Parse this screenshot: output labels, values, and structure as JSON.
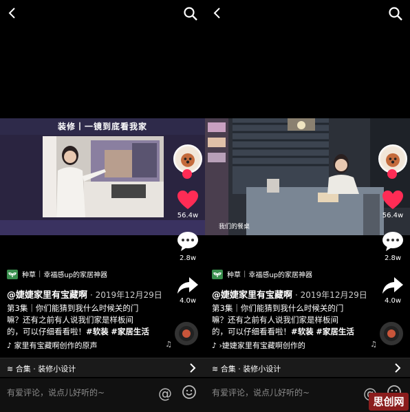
{
  "panels": [
    {
      "video_title": "装修丨一镜到底看我家",
      "video_caption": "",
      "likes": "56.4w",
      "comments": "2.8w",
      "shares": "4.0w",
      "tag": "种草",
      "tag_detail": "幸福感up的家居神器",
      "author": "@婕婕家里有宝藏啊",
      "date": "· 2019年12月29日",
      "desc_line1": "第3集｜你们能猜到我什么时候关的门",
      "desc_line2": "嘛？还有之前有人说我们家是样板间",
      "desc_line3_plain": "的，可以仔细看看啦！",
      "hashtag1": "#软装",
      "hashtag2": "#家居生活",
      "music": "家里有宝藏啊创作的原声",
      "collection": "合集 · 装修小设计",
      "comment_placeholder": "有爱评论，说点儿好听的~"
    },
    {
      "video_title": "",
      "video_caption": "我们的餐桌",
      "likes": "56.4w",
      "comments": "2.8w",
      "shares": "4.0w",
      "tag": "种草",
      "tag_detail": "幸福感up的家居神器",
      "author": "@婕婕家里有宝藏啊",
      "date": "· 2019年12月29日",
      "desc_line1": "第3集｜你们能猜到我什么时候关的门",
      "desc_line2": "嘛？还有之前有人说我们家是样板间",
      "desc_line3_plain": "的，可以仔细看看啦！",
      "hashtag1": "#软装",
      "hashtag2": "#家居生活",
      "music": "›婕婕家里有宝藏啊创作的",
      "collection": "合集 · 装修小设计",
      "comment_placeholder": "有爱评论，说点儿好听的~"
    }
  ],
  "watermark": "思创网",
  "colors": {
    "like": "#fe2c55",
    "tag": "#3a8f4e",
    "background": "#000000"
  },
  "icons": [
    "back-icon",
    "search-icon",
    "heart-icon",
    "comment-icon",
    "share-icon",
    "music-note-icon",
    "collection-icon",
    "chevron-right-icon",
    "at-icon",
    "emoji-icon"
  ]
}
